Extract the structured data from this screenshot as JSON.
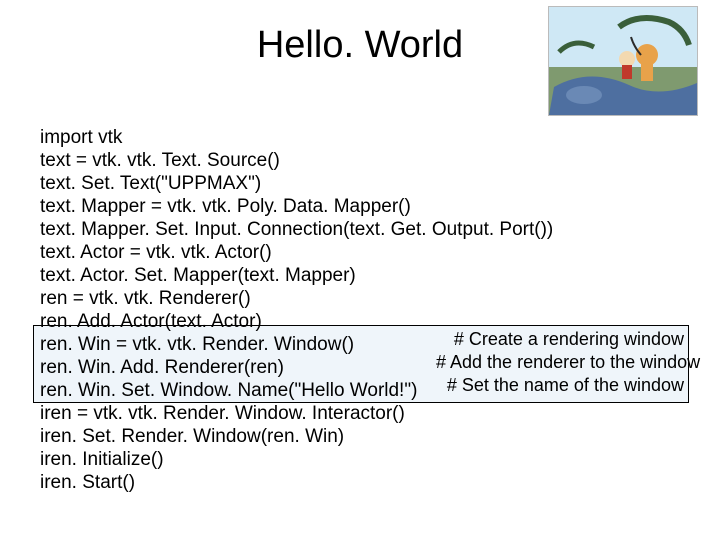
{
  "title": "Hello. World",
  "image_alt": "calvin-and-hobbes-river",
  "code": {
    "l0": "import vtk",
    "l1": "text = vtk. vtk. Text. Source()",
    "l2": "text. Set. Text(\"UPPMAX\")",
    "l3": "text. Mapper = vtk. vtk. Poly. Data. Mapper()",
    "l4": "text. Mapper. Set. Input. Connection(text. Get. Output. Port())",
    "l5": "text. Actor = vtk. vtk. Actor()",
    "l6": "text. Actor. Set. Mapper(text. Mapper)",
    "l7": "ren = vtk. vtk. Renderer()",
    "l8": "ren. Add. Actor(text. Actor)",
    "l9": "ren. Win = vtk. vtk. Render. Window()",
    "l10": "ren. Win. Add. Renderer(ren)",
    "l11": "ren. Win. Set. Window. Name(\"Hello World!\")",
    "l12": "iren = vtk. vtk. Render. Window. Interactor()",
    "l13": "iren. Set. Render. Window(ren. Win)",
    "l14": "iren. Initialize()",
    "l15": "iren. Start()"
  },
  "comments": {
    "c0": "# Create a rendering window",
    "c1": "# Add the renderer to the window",
    "c2": "# Set the name of the window"
  }
}
